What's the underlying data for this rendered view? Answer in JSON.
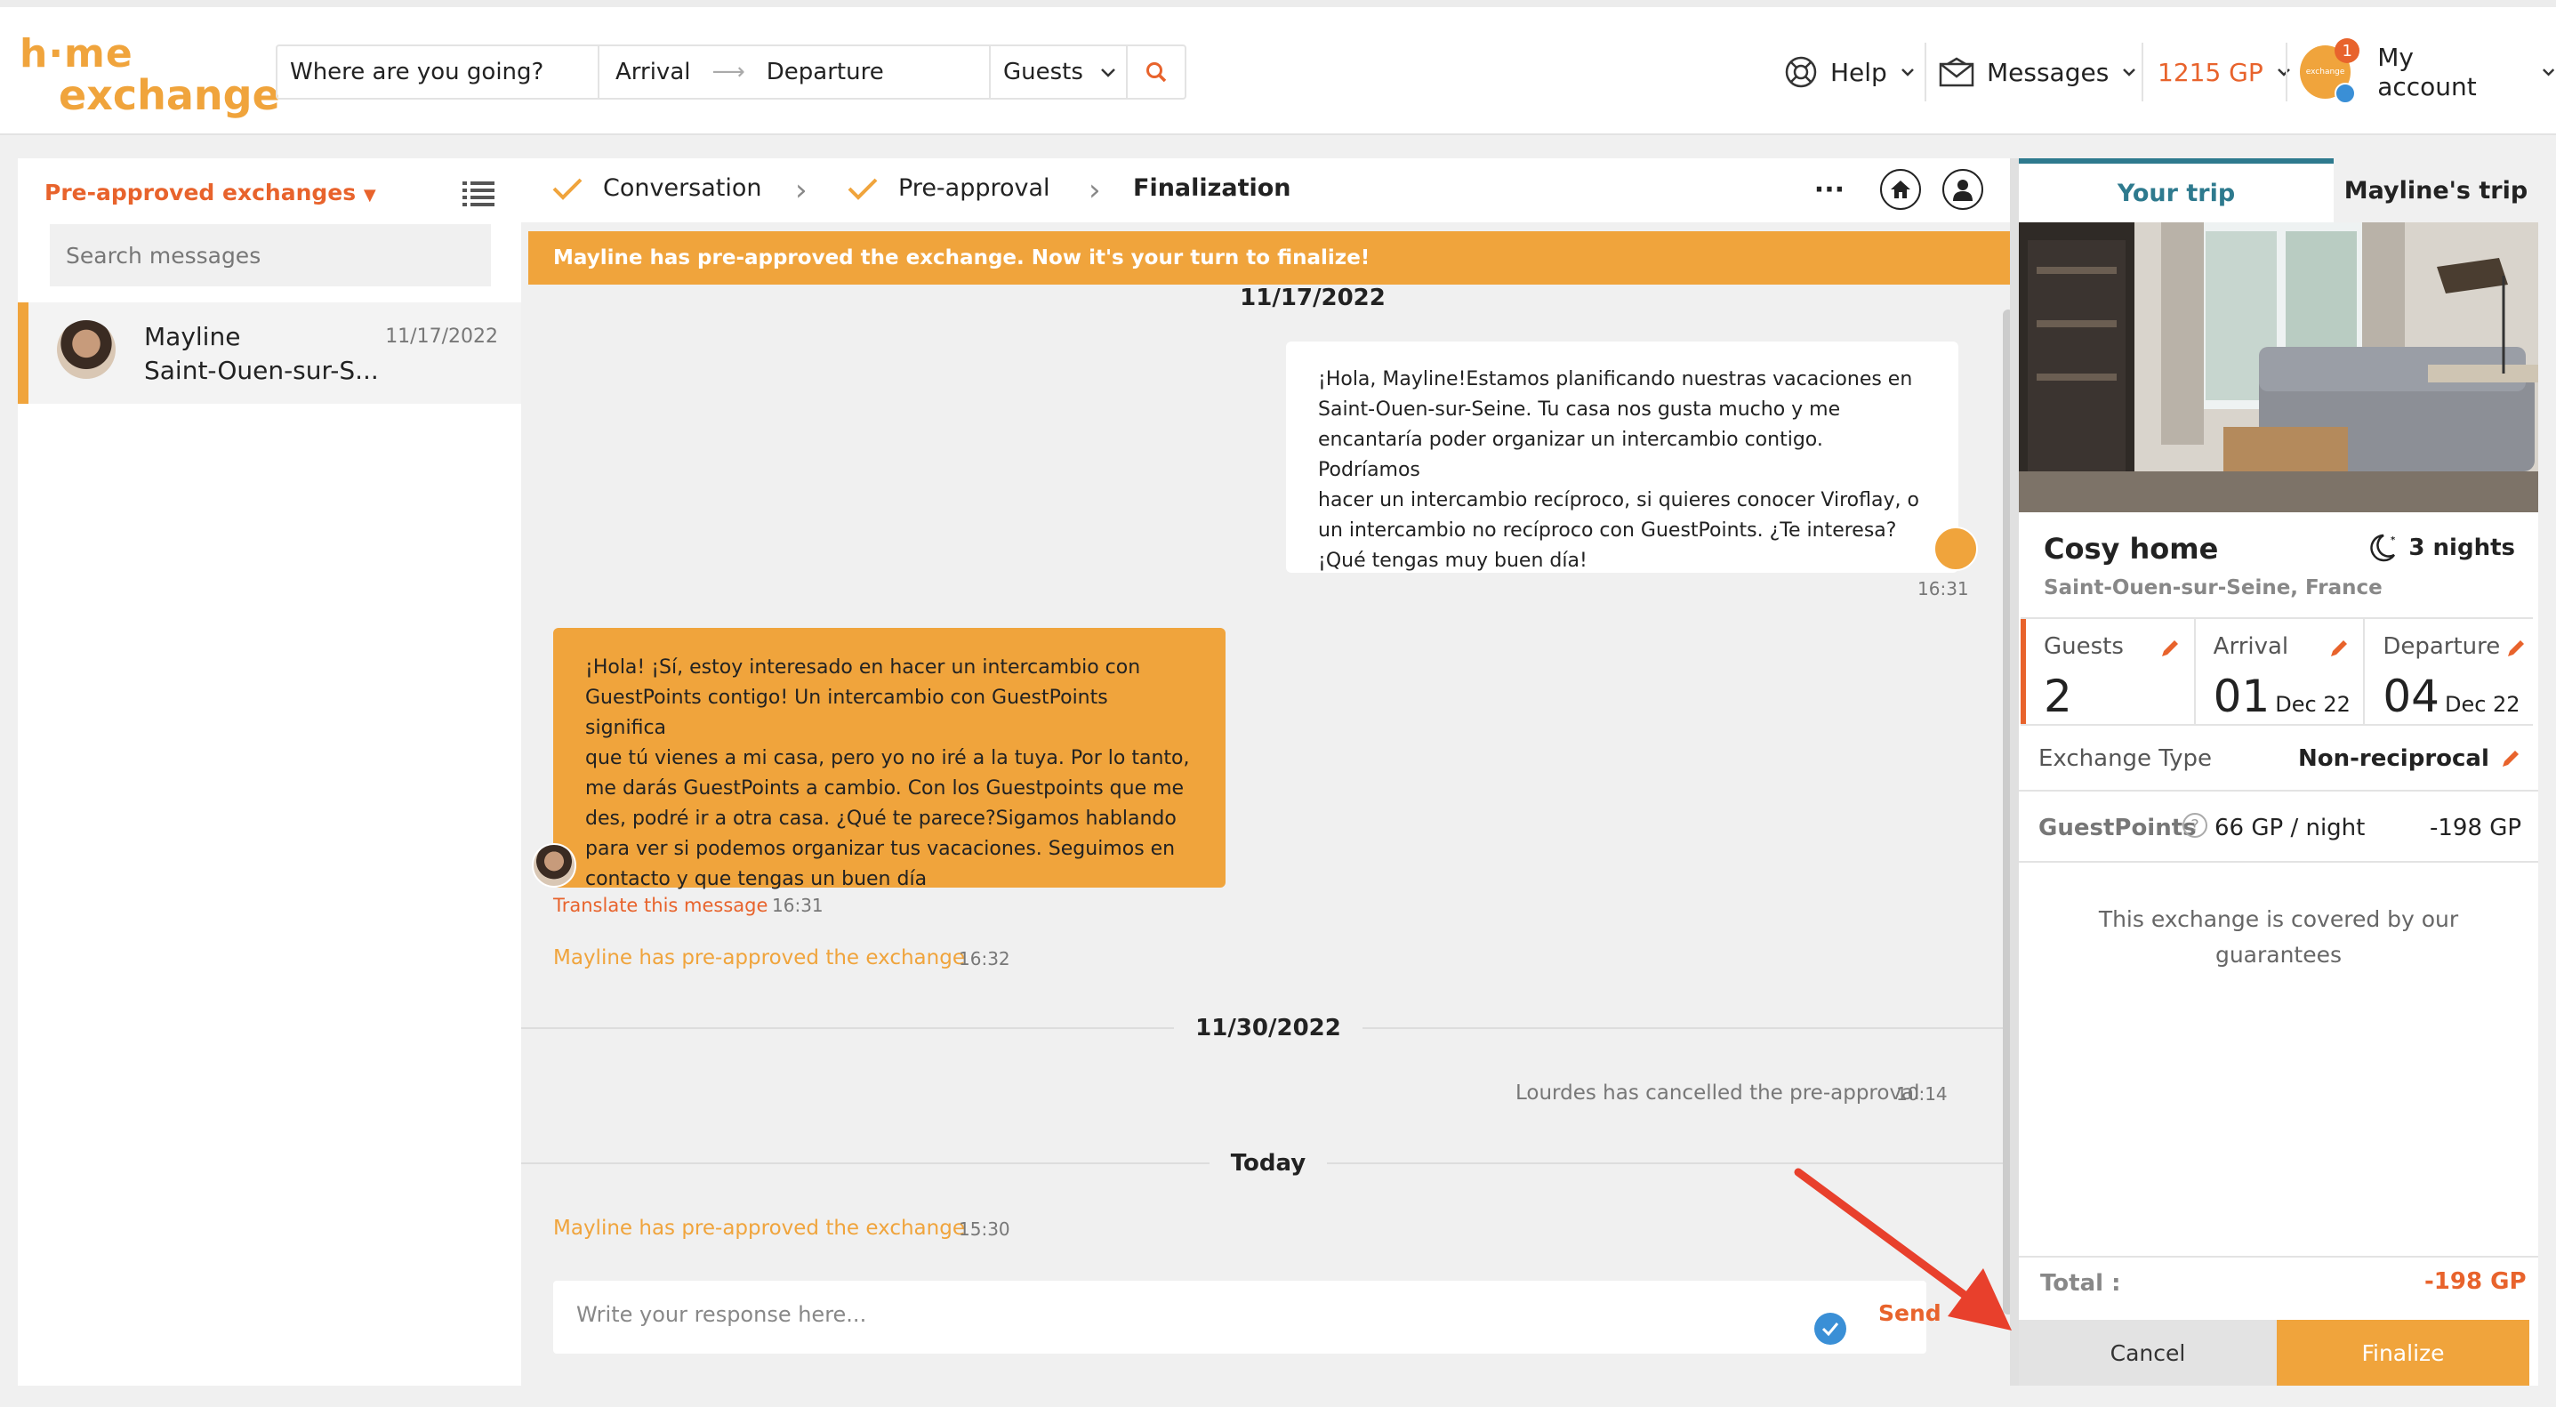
{
  "header": {
    "logo_line1": "h·me",
    "logo_line2": "exchange",
    "search": {
      "where_placeholder": "Where are you going?",
      "arrival": "Arrival",
      "departure": "Departure",
      "guests": "Guests"
    },
    "help": "Help",
    "messages": "Messages",
    "points": "1215 GP",
    "notifications": "1",
    "account": "My account"
  },
  "sidebar": {
    "filter": "Pre-approved exchanges",
    "search_placeholder": "Search messages",
    "conversations": [
      {
        "name": "Mayline",
        "location": "Saint-Ouen-sur-S...",
        "date": "11/17/2022"
      }
    ]
  },
  "steps": [
    {
      "label": "Conversation",
      "done": true
    },
    {
      "label": "Pre-approval",
      "done": true
    },
    {
      "label": "Finalization",
      "done": false
    }
  ],
  "banner": "Mayline has pre-approved the exchange. Now it's your turn to finalize!",
  "thread": {
    "top_date": "11/17/2022",
    "msg1": {
      "lines": [
        "¡Hola, Mayline!Estamos planificando nuestras vacaciones en",
        "Saint-Ouen-sur-Seine. Tu casa nos gusta mucho y me",
        "encantaría poder organizar un intercambio contigo. Podríamos",
        "hacer un intercambio recíproco, si quieres conocer Viroflay, o",
        "un intercambio no recíproco con GuestPoints. ¿Te interesa?",
        "¡Qué tengas muy buen día!"
      ],
      "time": "16:31"
    },
    "msg2": {
      "lines": [
        "¡Hola! ¡Sí, estoy interesado en hacer un intercambio con",
        "GuestPoints contigo! Un intercambio con GuestPoints significa",
        "que tú vienes a mi casa, pero yo no iré a la tuya. Por lo tanto,",
        "me darás GuestPoints a cambio. Con los Guestpoints que me",
        "des, podré ir a otra casa. ¿Qué te parece?Sigamos hablando",
        "para ver si podemos organizar tus vacaciones. Seguimos en",
        "contacto y que tengas un buen día"
      ],
      "translate": "Translate this message",
      "time": "16:31"
    },
    "sys1": {
      "text": "Mayline has pre-approved the exchange",
      "time": "16:32"
    },
    "date2": "11/30/2022",
    "sys2": {
      "text": "Lourdes has cancelled the pre-approval",
      "time": "10:14"
    },
    "date3": "Today",
    "sys3": {
      "text": "Mayline has pre-approved the exchange",
      "time": "15:30"
    }
  },
  "composer": {
    "placeholder": "Write your response here...",
    "send": "Send"
  },
  "trip": {
    "tab_yours": "Your trip",
    "tab_theirs": "Mayline's trip",
    "title": "Cosy home",
    "nights": "3 nights",
    "location": "Saint-Ouen-sur-Seine, France",
    "guests_label": "Guests",
    "guests_value": "2",
    "arrival_label": "Arrival",
    "arrival_day": "01",
    "arrival_month": "Dec 22",
    "departure_label": "Departure",
    "departure_day": "04",
    "departure_month": "Dec 22",
    "exchange_type_label": "Exchange Type",
    "exchange_type_value": "Non-reciprocal",
    "gp_label": "GuestPoints",
    "gp_rate": "66 GP / night",
    "gp_total": "-198 GP",
    "covered": "This exchange is covered by our guarantees",
    "total_label": "Total :",
    "total_value": "-198 GP",
    "cancel": "Cancel",
    "finalize": "Finalize"
  },
  "colors": {
    "accent": "#f0a43c",
    "orange_text": "#e8632c",
    "teal": "#2e7a8e",
    "annotation_red": "#e8402c"
  }
}
